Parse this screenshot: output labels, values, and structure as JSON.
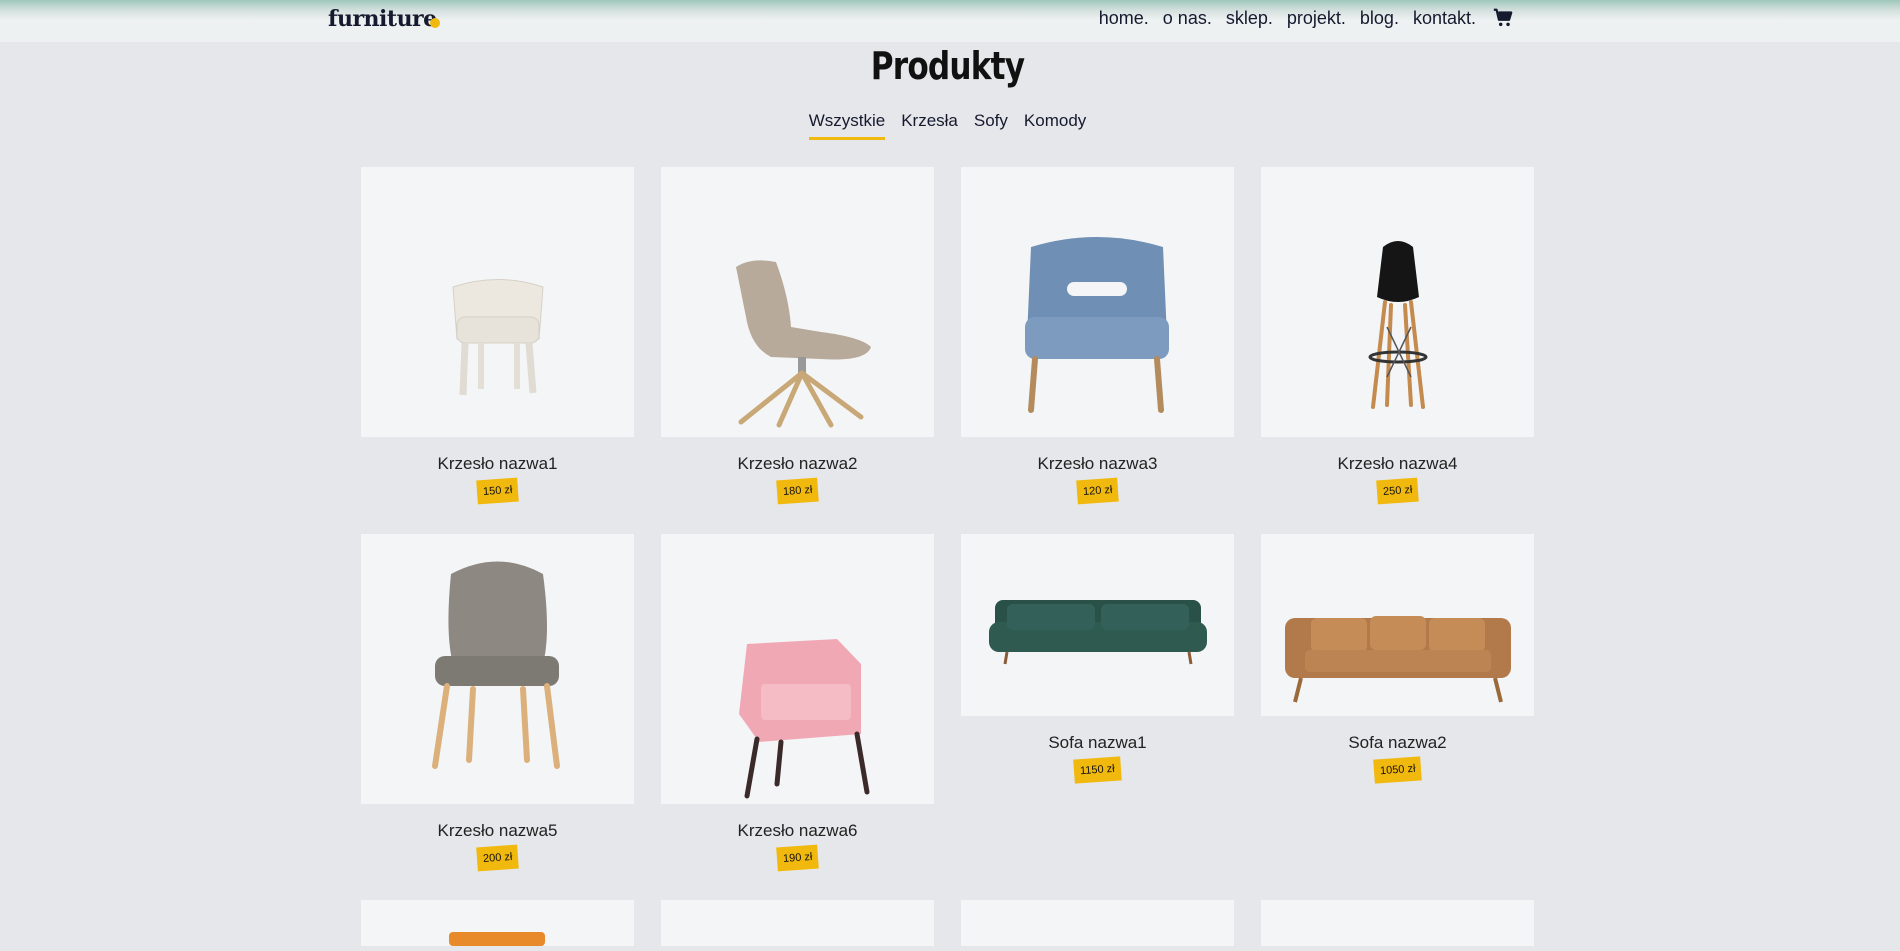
{
  "header": {
    "logo": "furniture",
    "nav": [
      "home.",
      "o nas.",
      "sklep.",
      "projekt.",
      "blog.",
      "kontakt."
    ]
  },
  "page_title": "Produkty",
  "tabs": [
    "Wszystkie",
    "Krzesła",
    "Sofy",
    "Komody"
  ],
  "products": [
    {
      "name": "Krzesło nazwa1",
      "price": "150 zł"
    },
    {
      "name": "Krzesło nazwa2",
      "price": "180 zł"
    },
    {
      "name": "Krzesło nazwa3",
      "price": "120 zł"
    },
    {
      "name": "Krzesło nazwa4",
      "price": "250 zł"
    },
    {
      "name": "Krzesło nazwa5",
      "price": "200 zł"
    },
    {
      "name": "Krzesło nazwa6",
      "price": "190 zł"
    },
    {
      "name": "Sofa nazwa1",
      "price": "1150 zł"
    },
    {
      "name": "Sofa nazwa2",
      "price": "1050 zł"
    }
  ],
  "colors": {
    "accent": "#f1b80e",
    "background": "#e6e7ea",
    "card": "#f4f5f7"
  }
}
